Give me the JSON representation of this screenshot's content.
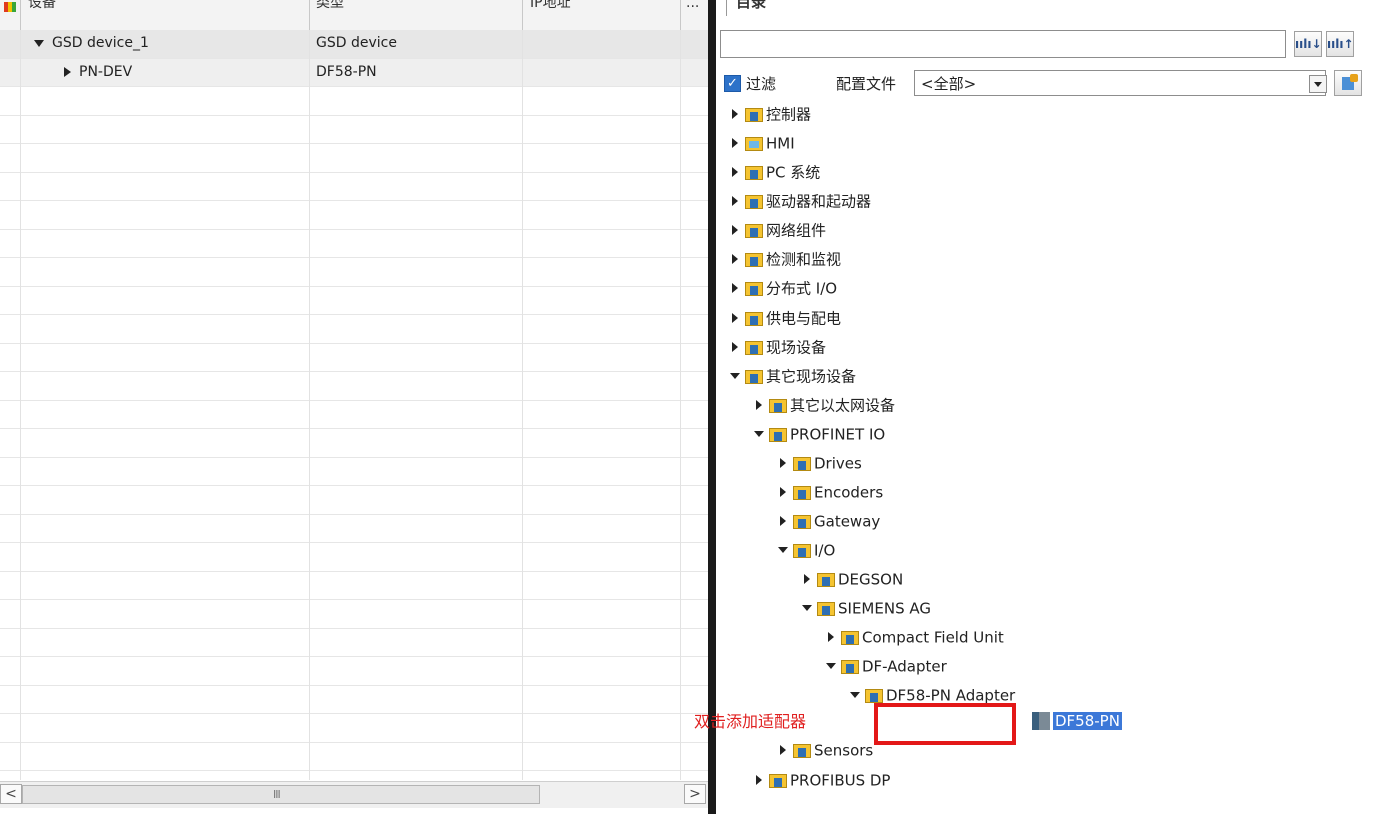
{
  "left_table": {
    "headers": [
      "设备",
      "类型",
      "IP地址",
      "..."
    ],
    "rows": [
      {
        "expanded": true,
        "device": "GSD device_1",
        "type": "GSD device",
        "ip": ""
      },
      {
        "expanded": false,
        "device": "PN-DEV",
        "type": "DF58-PN",
        "ip": ""
      }
    ],
    "scroll_grip": "III",
    "scroll_left": "<",
    "scroll_right": ">"
  },
  "catalog": {
    "panel_title": "目录",
    "search_value": "",
    "search_down_icon": "search-down-icon",
    "search_up_icon": "search-up-icon",
    "filter_checked": true,
    "filter_label": "过滤",
    "profile_label": "配置文件",
    "profile_value": "<全部>",
    "tree": [
      {
        "label": "控制器",
        "expanded": false
      },
      {
        "label": "HMI",
        "expanded": false
      },
      {
        "label": "PC 系统",
        "expanded": false
      },
      {
        "label": "驱动器和起动器",
        "expanded": false
      },
      {
        "label": "网络组件",
        "expanded": false
      },
      {
        "label": "检测和监视",
        "expanded": false
      },
      {
        "label": "分布式 I/O",
        "expanded": false
      },
      {
        "label": "供电与配电",
        "expanded": false
      },
      {
        "label": "现场设备",
        "expanded": false
      },
      {
        "label": "其它现场设备",
        "expanded": true
      },
      {
        "label": "其它以太网设备",
        "expanded": false
      },
      {
        "label": "PROFINET IO",
        "expanded": true
      },
      {
        "label": "Drives",
        "expanded": false
      },
      {
        "label": "Encoders",
        "expanded": false
      },
      {
        "label": "Gateway",
        "expanded": false
      },
      {
        "label": "I/O",
        "expanded": true
      },
      {
        "label": "DEGSON",
        "expanded": false
      },
      {
        "label": "SIEMENS AG",
        "expanded": true
      },
      {
        "label": "Compact Field Unit",
        "expanded": false
      },
      {
        "label": "DF-Adapter",
        "expanded": true
      },
      {
        "label": "DF58-PN Adapter",
        "expanded": true
      },
      {
        "label": "DF58-PN",
        "selected": true
      },
      {
        "label": "Sensors",
        "expanded": false
      },
      {
        "label": "PROFIBUS DP",
        "expanded": false
      }
    ]
  },
  "annotation": {
    "hint_text": "双击添加适配器",
    "color": "#e31818"
  }
}
